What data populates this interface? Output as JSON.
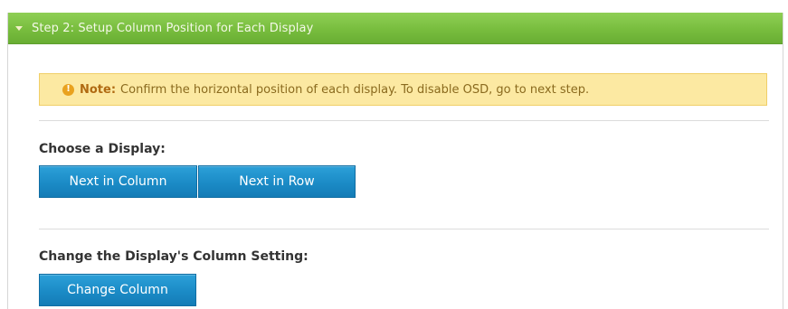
{
  "header": {
    "title": "Step 2: Setup Column Position for Each Display"
  },
  "note": {
    "label": "Note:",
    "text": "Confirm the horizontal position of each display. To disable OSD, go to next step."
  },
  "choose_display": {
    "label": "Choose a Display:",
    "buttons": [
      "Next in Column",
      "Next in Row"
    ]
  },
  "column_setting": {
    "label": "Change the Display's Column Setting:",
    "button": "Change Column"
  },
  "colors": {
    "header_green": "#78bd3e",
    "button_blue": "#1b8bc6",
    "note_yellow": "#fce9a2",
    "note_icon_orange": "#e9a21e"
  },
  "icons": {
    "header": "triangle-down-icon",
    "note": "info-icon"
  }
}
